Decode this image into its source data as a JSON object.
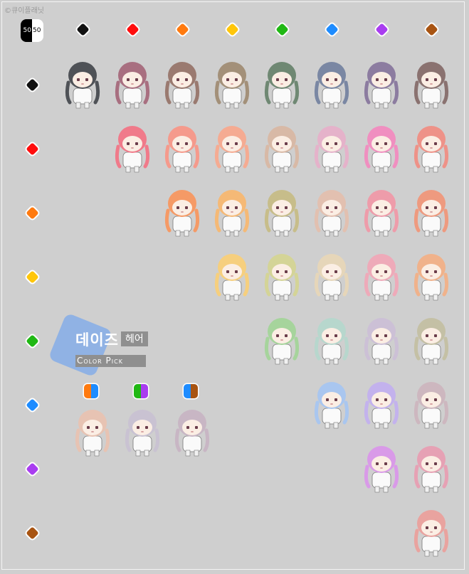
{
  "credit": "©큐이플래닛",
  "badge": {
    "left": "50",
    "right": "50"
  },
  "title": {
    "main": "데이즈",
    "sub": "헤어",
    "caption": "Color Pick"
  },
  "colors": {
    "black": "#111111",
    "red": "#ff0d0d",
    "orange": "#ff7a0f",
    "yellow": "#ffc60a",
    "green": "#20b814",
    "blue": "#1e8cff",
    "purple": "#a93df0",
    "brown": "#a85412"
  },
  "column_colors": [
    "black",
    "red",
    "orange",
    "yellow",
    "green",
    "blue",
    "purple",
    "brown"
  ],
  "row_colors": [
    "black",
    "red",
    "orange",
    "yellow",
    "green",
    "blue",
    "purple",
    "brown"
  ],
  "mix_swatches": [
    {
      "a": "orange",
      "b": "blue"
    },
    {
      "a": "green",
      "b": "purple"
    },
    {
      "a": "blue",
      "b": "brown"
    }
  ],
  "hair_palette": {
    "black-black": "#4f5257",
    "black-red": "#a86f80",
    "black-orange": "#9a7a70",
    "black-yellow": "#a39079",
    "black-green": "#6f8873",
    "black-blue": "#7a87a3",
    "black-purple": "#8c7ca0",
    "black-brown": "#8a7270",
    "red-red": "#f07a8a",
    "red-orange": "#f59a8c",
    "red-yellow": "#f5ab92",
    "red-green": "#d8b9a6",
    "red-blue": "#e5b2ca",
    "red-purple": "#f08fc0",
    "red-brown": "#ee9288",
    "orange-orange": "#f59a66",
    "orange-yellow": "#f5b976",
    "orange-green": "#c7bd8a",
    "orange-blue": "#e2c0b0",
    "orange-purple": "#ee9caa",
    "orange-brown": "#ee9a7f",
    "yellow-yellow": "#f6cf7e",
    "yellow-green": "#d4d497",
    "yellow-blue": "#e6d6b9",
    "yellow-purple": "#eeaab9",
    "yellow-brown": "#f0b28b",
    "green-green": "#a6d49c",
    "green-blue": "#b7d7cd",
    "green-purple": "#ccc0d6",
    "green-brown": "#c4c0a5",
    "blue-blue": "#a9c6ef",
    "blue-purple": "#c3b2ed",
    "blue-brown": "#cdb7bf",
    "purple-purple": "#d99ae8",
    "purple-brown": "#e6a1b4",
    "brown-brown": "#e9a39f",
    "mix-0": "#e7c3b3",
    "mix-1": "#c9c2d2",
    "mix-2": "#c8b6c4"
  }
}
